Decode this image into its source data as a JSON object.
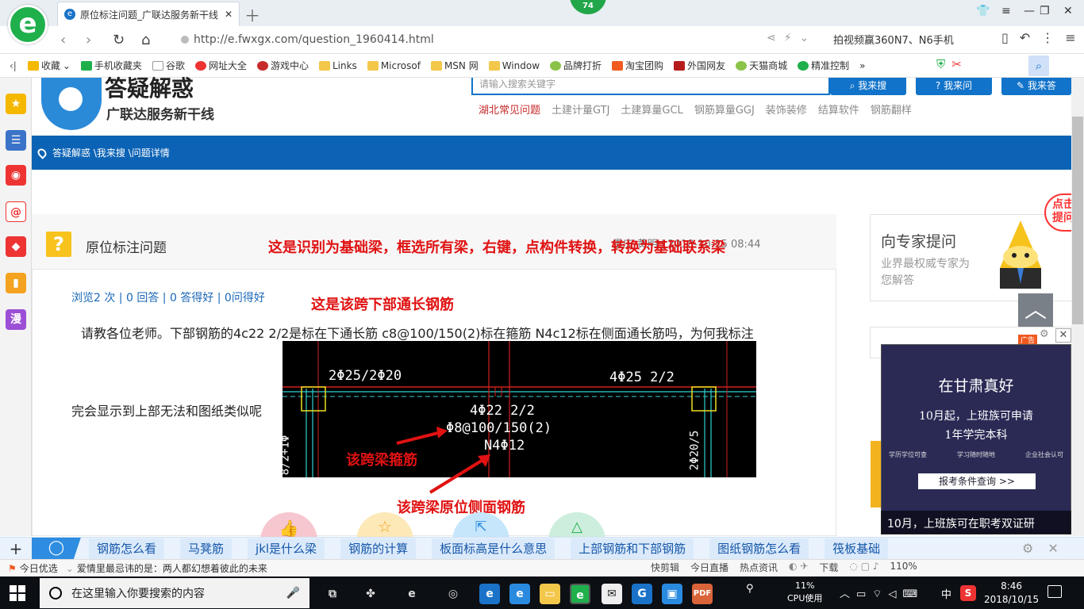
{
  "browser": {
    "tab_title": "原位标注问题_广联达服务新干线",
    "score_badge": "74",
    "url": "http://e.fwxgx.com/question_1960414.html",
    "ad_text": "拍视频赢360N7、N6手机",
    "bookmarks": [
      "收藏",
      "手机收藏夹",
      "谷歌",
      "网址大全",
      "游戏中心",
      "Links",
      "Microsof",
      "MSN 网",
      "Window",
      "品牌打折",
      "淘宝团购",
      "外国网友",
      "天猫商城",
      "精准控制"
    ],
    "more": "»"
  },
  "site": {
    "logo_text": "答疑解惑",
    "logo_sub": "广联达服务新干线",
    "search_placeholder": "请输入搜索关键字",
    "btn_search": "我来搜",
    "btn_ask": "我来问",
    "btn_answer": "我来答",
    "categories": [
      "湖北常见问题",
      "土建计量GTJ",
      "土建算量GCL",
      "钢筋算量GGJ",
      "装饰装修",
      "结算软件",
      "钢筋翻样"
    ],
    "breadcrumb": "答疑解惑 \\我来搜 \\问题详情"
  },
  "question": {
    "title": "原位标注问题",
    "meta": "重庆-黄明 | 2018-10-15 08:44",
    "stats": "浏览2 次 | 0 回答 | 0 答得好 | 0问得好",
    "text1": "请教各位老师。下部钢筋的4c22 2/2是标在下通长筋 c8@100/150(2)标在箍筋 N4c12标在侧面通长筋吗，为何我标注",
    "text2": "完会显示到上部无法和图纸类似呢",
    "ann1": "这是识别为基础梁，框选所有梁，右键，点构件转换，转换为基础联系梁",
    "ann2": "这是该跨下部通长钢筋",
    "ann3": "该跨梁箍筋",
    "ann4": "该跨梁原位侧面钢筋",
    "cad": {
      "top_left": "2Φ25/2Φ20",
      "top_right": "4Φ25 2/2",
      "bottom": "4Φ22 2/2",
      "stirrup": "Φ8@100/150(2)",
      "side": "N4Φ12",
      "left_vert": "8/2+1Φ",
      "right_vert": "2Φ20/5"
    }
  },
  "sidebar": {
    "expert_title": "向专家提问",
    "expert_sub": "业界最权威专家为您解答",
    "peek": "点击提问",
    "ad_tag": "广告",
    "ad_title": "在甘肃真好",
    "ad_line1": "10月起，上班族可申请",
    "ad_line2": "1年学完本科",
    "ad_line3": [
      "学历学位可查",
      "学习随时随地",
      "企业社会认可"
    ],
    "ad_btn": "报考条件查询 >>",
    "ad_caption": "10月，上班族可在职考双证研"
  },
  "hotbar": {
    "items": [
      "钢筋怎么看",
      "马凳筋",
      "jkl是什么梁",
      "钢筋的计算",
      "板面标高是什么意思",
      "上部钢筋和下部钢筋",
      "图纸钢筋怎么看",
      "筏板基础"
    ]
  },
  "statusbar": {
    "today": "今日优选",
    "news": "爱情里最忌讳的是：两人都幻想着彼此的未来",
    "right": [
      "快剪辑",
      "今日直播",
      "热点资讯",
      "下载",
      "110%"
    ]
  },
  "taskbar": {
    "search_placeholder": "在这里输入你要搜索的内容",
    "cpu_pct": "11%",
    "cpu_label": "CPU使用",
    "ime": "中",
    "time": "8:46",
    "date": "2018/10/15"
  },
  "colors": {
    "accent": "#0c63b5",
    "browser_green": "#1fb04c",
    "annotation_red": "#e01212"
  }
}
